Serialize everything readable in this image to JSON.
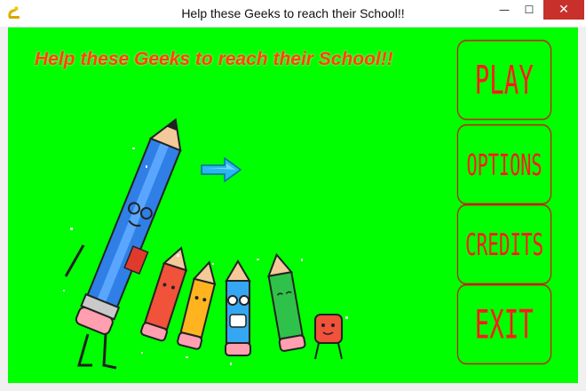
{
  "window": {
    "title": "Help these Geeks to reach their School!!",
    "icon": "pygame-snake-icon",
    "minimize": "—",
    "maximize": "☐",
    "close": "✕"
  },
  "game": {
    "title": "Help these Geeks to reach their School!!",
    "background_color": "#00ff00",
    "title_color": "#ff4500",
    "menu": {
      "play": "PLAY",
      "options": "OPTIONS",
      "credits": "CREDITS",
      "exit": "EXIT"
    },
    "menu_color": "#ff1a1a",
    "cursor_icon": "blue-arrow-icon",
    "artwork": "cartoon-pencils-illustration"
  }
}
